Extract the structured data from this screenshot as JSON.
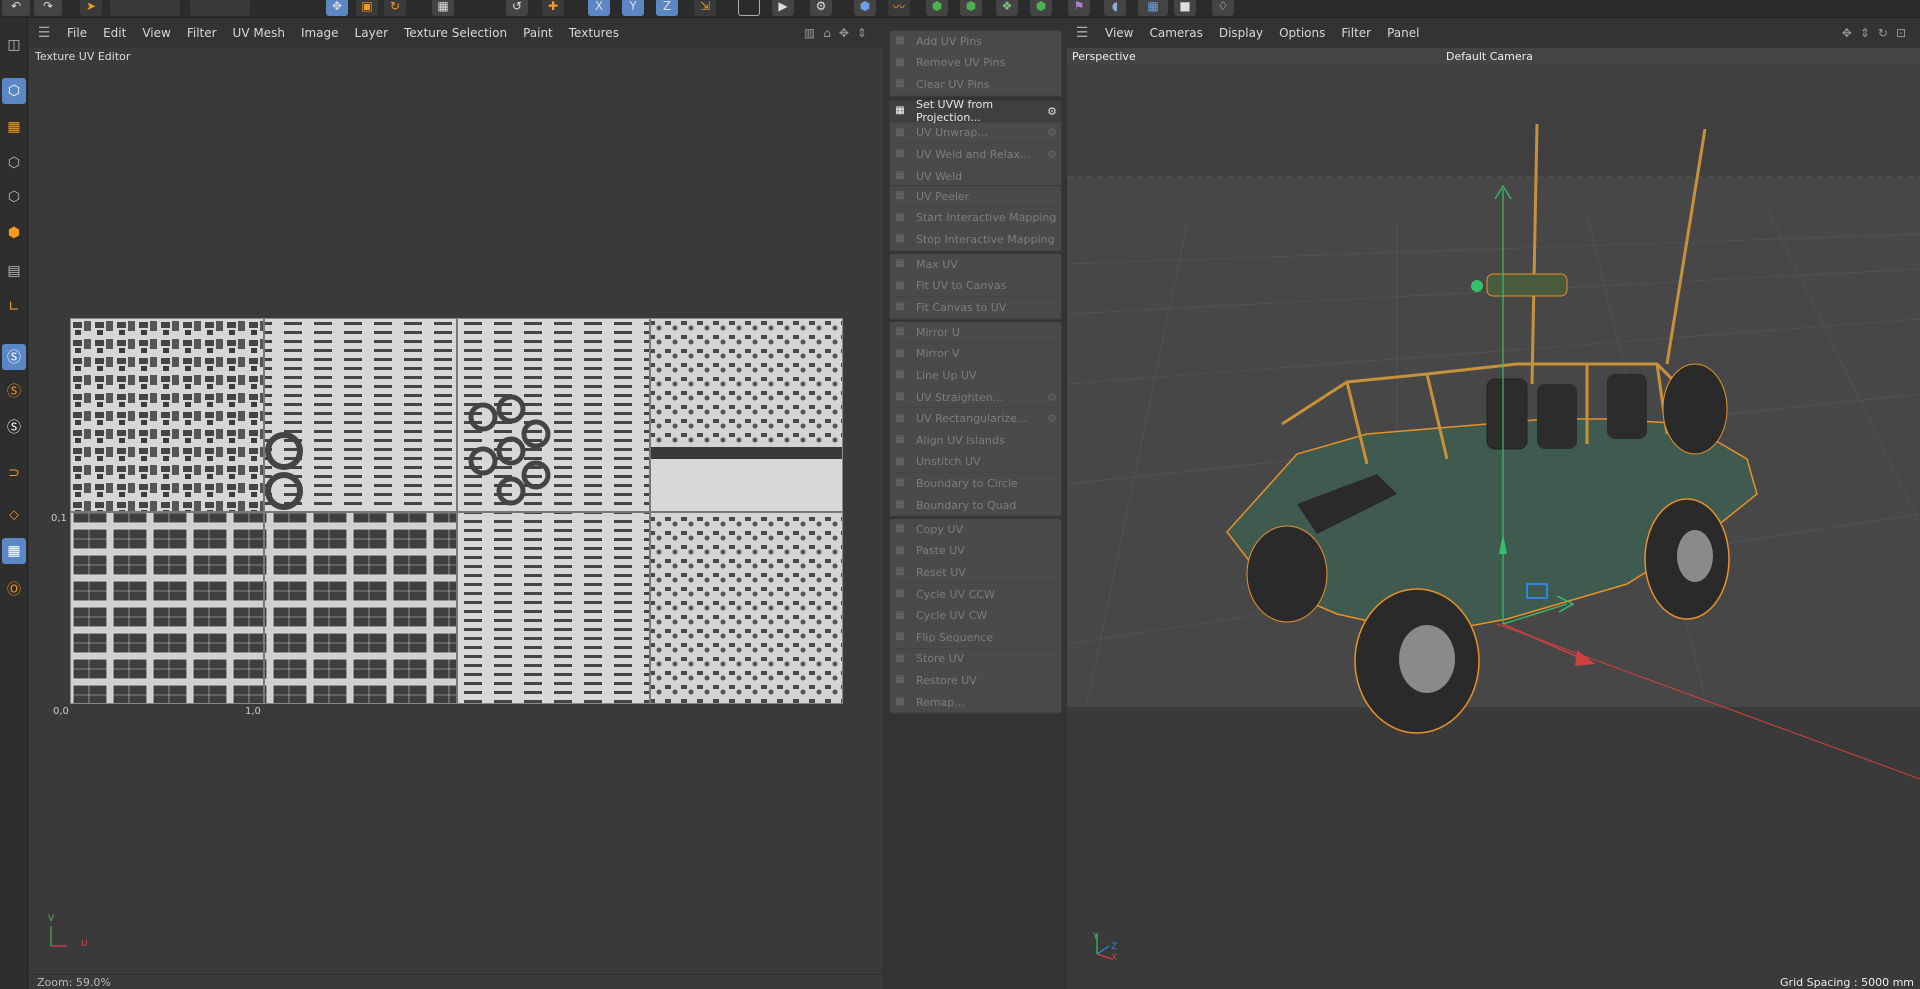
{
  "toolbar": {
    "icons": [
      "undo-icon",
      "redo-icon",
      "select-arrow-icon",
      "move-icon",
      "scale-icon",
      "rotate-icon",
      "checker-icon",
      "reset-icon",
      "add-icon",
      "axis-x-icon",
      "axis-y-icon",
      "axis-z-icon",
      "coord-icon",
      "render-region-icon",
      "render-view-icon",
      "render-settings-icon",
      "cube-icon",
      "spline-icon",
      "nurbs-icon",
      "deformer-icon",
      "generator-icon",
      "field-icon",
      "tag-icon",
      "floor-icon",
      "camera-icon",
      "light-icon"
    ],
    "axis_labels": [
      "X",
      "Y",
      "Z"
    ]
  },
  "uv_editor": {
    "menu": [
      "File",
      "Edit",
      "View",
      "Filter",
      "UV Mesh",
      "Image",
      "Layer",
      "Texture Selection",
      "Paint",
      "Textures"
    ],
    "title": "Texture UV Editor",
    "label_0_1": "0,1",
    "label_0_0": "0,0",
    "label_1_0": "1,0",
    "axis_v": "V",
    "axis_u": "U",
    "zoom": "Zoom: 59.0%"
  },
  "commands": {
    "groups": [
      [
        "Add UV Pins",
        "Remove UV Pins",
        "Clear UV Pins"
      ],
      [
        "Set UVW from Projection...",
        "UV Unwrap...",
        "UV Weld and Relax...",
        "UV Weld"
      ],
      [
        "UV Peeler",
        "Start Interactive Mapping",
        "Stop Interactive Mapping"
      ],
      [
        "Max UV",
        "Fit UV to Canvas",
        "Fit Canvas to UV"
      ],
      [
        "Mirror U",
        "Mirror V",
        "Line Up UV",
        "UV Straighten...",
        "UV Rectangularize...",
        "Align UV Islands",
        "Unstitch UV",
        "Boundary to Circle",
        "Boundary to Quad"
      ],
      [
        "Copy UV",
        "Paste UV",
        "Reset UV",
        "Cycle UV CCW",
        "Cycle UV CW",
        "Flip Sequence",
        "Store UV",
        "Restore UV",
        "Remap..."
      ]
    ],
    "active": "Set UVW from Projection...",
    "with_settings": [
      "Set UVW from Projection...",
      "UV Unwrap...",
      "UV Weld and Relax...",
      "UV Straighten...",
      "UV Rectangularize..."
    ]
  },
  "viewport": {
    "menu": [
      "View",
      "Cameras",
      "Display",
      "Options",
      "Filter",
      "Panel"
    ],
    "projection": "Perspective",
    "camera": "Default Camera",
    "grid_spacing": "Grid Spacing : 5000 mm",
    "axis_labels": [
      "Y",
      "Z",
      "X"
    ]
  },
  "colors": {
    "accent_blue": "#5b87c5",
    "accent_orange": "#f39a1e",
    "selection_outline": "#e8912a",
    "vehicle_body": "#3f5a4e"
  }
}
